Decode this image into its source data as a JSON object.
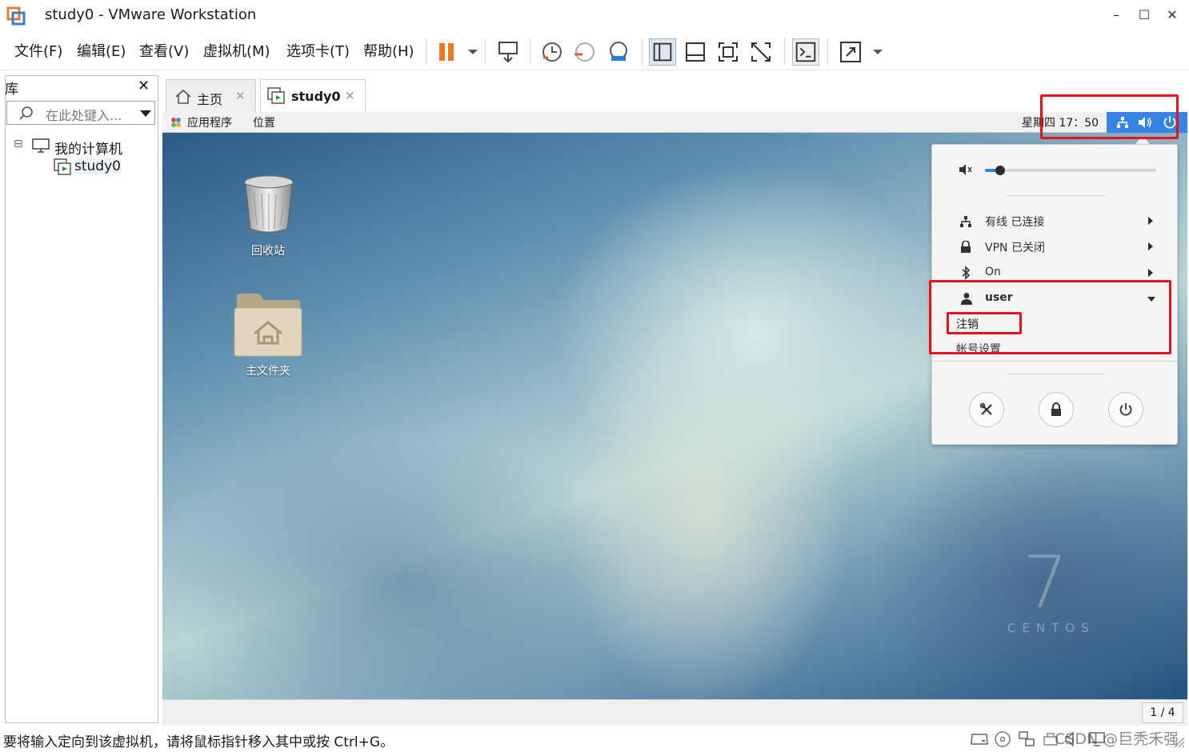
{
  "window": {
    "title": "study0 - VMware Workstation",
    "minimize": "–",
    "maximize": "☐",
    "close": "✕"
  },
  "menubar": {
    "items": [
      "文件(F)",
      "编辑(E)",
      "查看(V)",
      "虚拟机(M)",
      "选项卡(T)",
      "帮助(H)"
    ]
  },
  "library": {
    "title": "库",
    "close": "✕",
    "search_placeholder": "在此处键入...",
    "tree": {
      "root": "我的计算机",
      "expander": "⊟",
      "children": [
        "study0"
      ]
    }
  },
  "tabs": [
    {
      "label": "主页",
      "close": "✕"
    },
    {
      "label": "study0",
      "close": "✕"
    }
  ],
  "gnome": {
    "apps": "应用程序",
    "places": "位置",
    "clock": "星期四 17：50"
  },
  "desktop": {
    "icons": [
      {
        "label": "回收站"
      },
      {
        "label": "主文件夹"
      }
    ],
    "brand_number": "7",
    "brand_text": "CENTOS"
  },
  "system_menu": {
    "volume_level": 0.07,
    "rows": [
      {
        "label": "有线 已连接"
      },
      {
        "label": "VPN 已关闭"
      },
      {
        "label": "On"
      }
    ],
    "user": {
      "name": "user",
      "items": [
        "注销",
        "帐号设置"
      ]
    }
  },
  "vm_status": {
    "page": "1 / 4"
  },
  "statusbar": {
    "text": "要将输入定向到该虚拟机，请将鼠标指针移入其中或按 Ctrl+G。",
    "watermark": "CSDN @巨秃禾强"
  },
  "colors": {
    "highlight_red": "#e8111b",
    "accent_orange": "#f07822",
    "gnome_blue": "#3584e4"
  }
}
